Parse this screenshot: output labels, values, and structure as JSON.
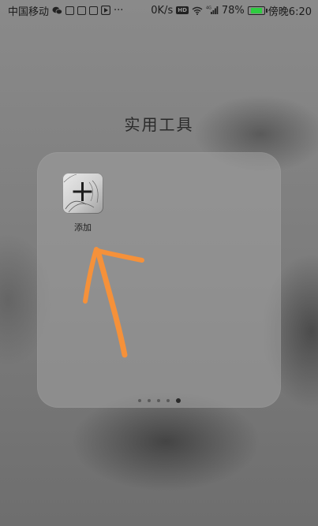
{
  "status_bar": {
    "carrier": "中国移动",
    "more": "···",
    "speed": "0K/s",
    "hd": "HD",
    "signal_label": "4G",
    "battery": "78%",
    "time": "傍晚6:20",
    "battery_level": 0.78,
    "battery_color": "#2ecc40"
  },
  "folder": {
    "title": "实用工具",
    "apps": [
      {
        "label": "添加",
        "icon": "plus-icon"
      }
    ],
    "pages": 5,
    "active_page": 5
  },
  "annotation": {
    "color": "#f5913a",
    "icon": "arrow-annotation"
  }
}
